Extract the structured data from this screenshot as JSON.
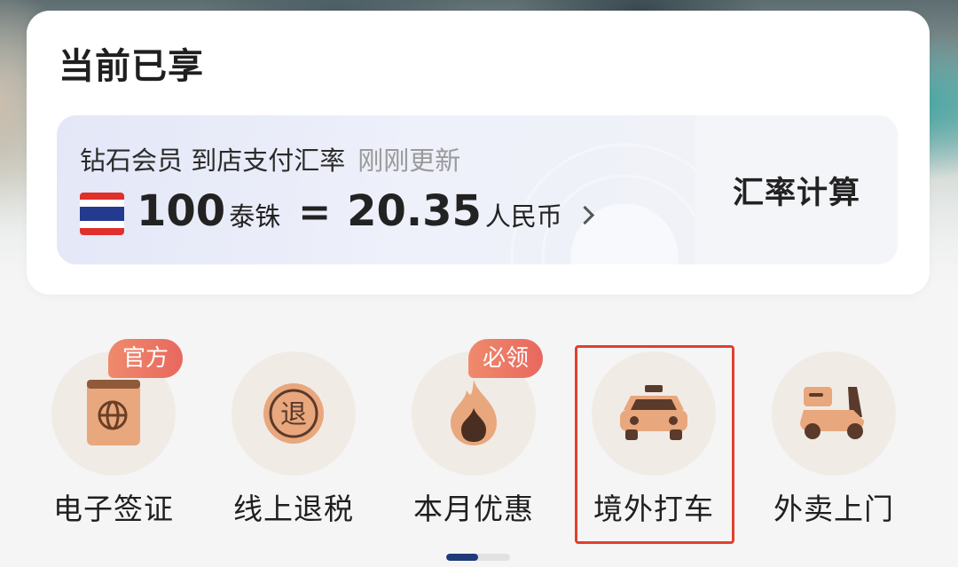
{
  "card": {
    "title": "当前已享",
    "rate": {
      "subtitle": "钻石会员 到店支付汇率",
      "updated": "刚刚更新",
      "from_amount": "100",
      "from_unit": "泰铢",
      "equals": "=",
      "to_amount": "20.35",
      "to_unit": "人民币",
      "flag_icon": "thailand-flag-icon"
    },
    "calc_label": "汇率计算"
  },
  "services": [
    {
      "label": "电子签证",
      "icon": "passport-icon",
      "badge": "官方"
    },
    {
      "label": "线上退税",
      "icon": "tax-refund-icon",
      "badge": ""
    },
    {
      "label": "本月优惠",
      "icon": "flame-icon",
      "badge": "必领"
    },
    {
      "label": "境外打车",
      "icon": "taxi-icon",
      "badge": ""
    },
    {
      "label": "外卖上门",
      "icon": "scooter-icon",
      "badge": ""
    }
  ],
  "highlight_color": "#e0402f",
  "accent_color": "#e8685e",
  "page_indicator": {
    "pages": 2,
    "active": 1
  }
}
